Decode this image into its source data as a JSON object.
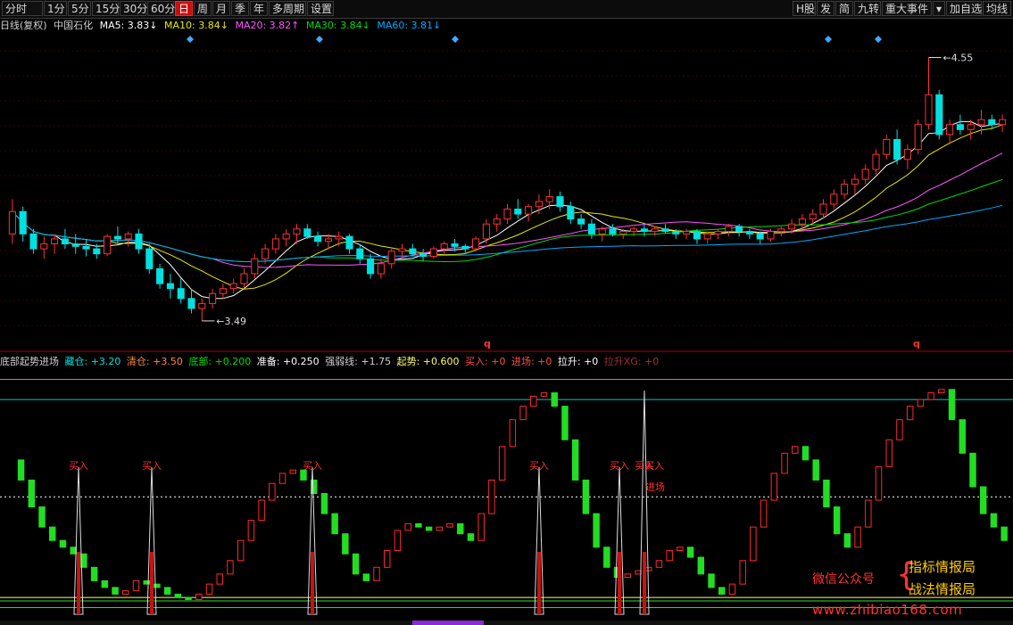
{
  "toolbar": {
    "left_items": [
      {
        "label": "分时",
        "name": "period-fenshi"
      },
      {
        "label": "1分",
        "name": "period-1min"
      },
      {
        "label": "5分",
        "name": "period-5min"
      },
      {
        "label": "15分",
        "name": "period-15min"
      },
      {
        "label": "30分",
        "name": "period-30min"
      },
      {
        "label": "60分",
        "name": "period-60min"
      },
      {
        "label": "日",
        "name": "period-day",
        "active": true
      },
      {
        "label": "周",
        "name": "period-week"
      },
      {
        "label": "月",
        "name": "period-month"
      },
      {
        "label": "季",
        "name": "period-quarter"
      },
      {
        "label": "年",
        "name": "period-year"
      },
      {
        "label": "多周期",
        "name": "period-multi"
      },
      {
        "label": "设置",
        "name": "settings"
      }
    ],
    "right_items": [
      {
        "label": "H股",
        "name": "h-share"
      },
      {
        "label": "发",
        "name": "fa"
      },
      {
        "label": "简",
        "name": "jian"
      },
      {
        "label": "九转",
        "name": "jiuzhuan"
      },
      {
        "label": "重大事件",
        "name": "major-events"
      },
      {
        "label": "▾",
        "name": "dropdown"
      },
      {
        "label": "加自选",
        "name": "add-watchlist"
      },
      {
        "label": "均线",
        "name": "ma-lines"
      }
    ]
  },
  "main_info": {
    "period": "日线(复权)",
    "stock": "中国石化",
    "ma5": "MA5: 3.83↓",
    "ma10": "MA10: 3.84↓",
    "ma20": "MA20: 3.82↑",
    "ma30": "MA30: 3.84↓",
    "ma60": "MA60: 3.81↓"
  },
  "price_labels": {
    "high": "4.55",
    "low": "3.49"
  },
  "markers": {
    "q": "q"
  },
  "sub_info": {
    "name": "底部起势进场",
    "cang": "藏仓: +3.20",
    "qingcang": "清仓: +3.50",
    "dibu": "底部: +0.200",
    "zhunbei": "准备: +0.250",
    "qiangruo": "强弱线: +1.75",
    "qishi": "起势: +0.600",
    "mairu": "买入: +0",
    "jinchang": "进场: +0",
    "lasheng": "拉升: +0",
    "lashengxg": "拉升XG: +0"
  },
  "signals": {
    "buy": "买入",
    "enter": "进场"
  },
  "watermark": {
    "wechat": "微信公众号",
    "line1": "指标情报局",
    "line2": "战法情报局",
    "url": "www.zhibiao168.com"
  },
  "colors": {
    "up": "#ff3232",
    "down": "#00e0e0",
    "ma5": "#ffffff",
    "ma10": "#e8e800",
    "ma20": "#ff55ff",
    "ma30": "#00dd00",
    "ma60": "#00aaff",
    "osc_up": "#ff2a2a",
    "osc_down": "#22dd22"
  },
  "chart_data": {
    "type": "candlestick",
    "candles": [
      [
        3.84,
        3.98,
        3.8,
        3.93
      ],
      [
        3.93,
        3.95,
        3.81,
        3.84
      ],
      [
        3.84,
        3.86,
        3.76,
        3.78
      ],
      [
        3.78,
        3.83,
        3.74,
        3.8
      ],
      [
        3.8,
        3.84,
        3.76,
        3.82
      ],
      [
        3.82,
        3.86,
        3.78,
        3.8
      ],
      [
        3.8,
        3.84,
        3.76,
        3.79
      ],
      [
        3.79,
        3.82,
        3.75,
        3.78
      ],
      [
        3.78,
        3.8,
        3.74,
        3.76
      ],
      [
        3.76,
        3.84,
        3.75,
        3.83
      ],
      [
        3.83,
        3.87,
        3.8,
        3.82
      ],
      [
        3.82,
        3.85,
        3.79,
        3.84
      ],
      [
        3.84,
        3.86,
        3.76,
        3.78
      ],
      [
        3.78,
        3.8,
        3.68,
        3.7
      ],
      [
        3.7,
        3.72,
        3.62,
        3.64
      ],
      [
        3.64,
        3.68,
        3.58,
        3.62
      ],
      [
        3.62,
        3.66,
        3.56,
        3.58
      ],
      [
        3.58,
        3.62,
        3.52,
        3.54
      ],
      [
        3.54,
        3.58,
        3.49,
        3.56
      ],
      [
        3.56,
        3.62,
        3.54,
        3.6
      ],
      [
        3.6,
        3.64,
        3.58,
        3.62
      ],
      [
        3.62,
        3.66,
        3.6,
        3.64
      ],
      [
        3.64,
        3.7,
        3.62,
        3.68
      ],
      [
        3.68,
        3.76,
        3.66,
        3.74
      ],
      [
        3.74,
        3.8,
        3.72,
        3.78
      ],
      [
        3.78,
        3.84,
        3.76,
        3.82
      ],
      [
        3.82,
        3.86,
        3.79,
        3.84
      ],
      [
        3.84,
        3.88,
        3.8,
        3.86
      ],
      [
        3.86,
        3.88,
        3.82,
        3.83
      ],
      [
        3.83,
        3.85,
        3.79,
        3.81
      ],
      [
        3.81,
        3.84,
        3.78,
        3.82
      ],
      [
        3.82,
        3.85,
        3.79,
        3.83
      ],
      [
        3.83,
        3.84,
        3.76,
        3.78
      ],
      [
        3.78,
        3.8,
        3.72,
        3.74
      ],
      [
        3.74,
        3.76,
        3.66,
        3.68
      ],
      [
        3.68,
        3.74,
        3.66,
        3.72
      ],
      [
        3.72,
        3.78,
        3.7,
        3.77
      ],
      [
        3.77,
        3.8,
        3.74,
        3.78
      ],
      [
        3.78,
        3.8,
        3.75,
        3.76
      ],
      [
        3.76,
        3.78,
        3.73,
        3.75
      ],
      [
        3.75,
        3.79,
        3.74,
        3.78
      ],
      [
        3.78,
        3.81,
        3.76,
        3.8
      ],
      [
        3.8,
        3.82,
        3.77,
        3.79
      ],
      [
        3.79,
        3.8,
        3.76,
        3.78
      ],
      [
        3.78,
        3.83,
        3.77,
        3.82
      ],
      [
        3.82,
        3.9,
        3.8,
        3.88
      ],
      [
        3.88,
        3.92,
        3.85,
        3.9
      ],
      [
        3.9,
        3.96,
        3.88,
        3.94
      ],
      [
        3.94,
        3.98,
        3.9,
        3.92
      ],
      [
        3.92,
        3.96,
        3.89,
        3.95
      ],
      [
        3.95,
        4.0,
        3.92,
        3.97
      ],
      [
        3.97,
        4.02,
        3.94,
        3.99
      ],
      [
        3.99,
        4.01,
        3.93,
        3.95
      ],
      [
        3.95,
        3.97,
        3.88,
        3.9
      ],
      [
        3.9,
        3.92,
        3.86,
        3.88
      ],
      [
        3.88,
        3.9,
        3.82,
        3.84
      ],
      [
        3.84,
        3.87,
        3.81,
        3.86
      ],
      [
        3.86,
        3.88,
        3.83,
        3.84
      ],
      [
        3.84,
        3.86,
        3.82,
        3.85
      ],
      [
        3.85,
        3.87,
        3.83,
        3.86
      ],
      [
        3.86,
        3.88,
        3.83,
        3.85
      ],
      [
        3.85,
        3.87,
        3.83,
        3.86
      ],
      [
        3.86,
        3.88,
        3.84,
        3.85
      ],
      [
        3.85,
        3.86,
        3.82,
        3.84
      ],
      [
        3.84,
        3.86,
        3.82,
        3.85
      ],
      [
        3.85,
        3.86,
        3.8,
        3.82
      ],
      [
        3.82,
        3.85,
        3.8,
        3.84
      ],
      [
        3.84,
        3.86,
        3.82,
        3.85
      ],
      [
        3.85,
        3.88,
        3.83,
        3.87
      ],
      [
        3.87,
        3.88,
        3.83,
        3.85
      ],
      [
        3.85,
        3.86,
        3.82,
        3.84
      ],
      [
        3.84,
        3.85,
        3.8,
        3.82
      ],
      [
        3.82,
        3.86,
        3.81,
        3.85
      ],
      [
        3.85,
        3.87,
        3.83,
        3.86
      ],
      [
        3.86,
        3.9,
        3.84,
        3.88
      ],
      [
        3.88,
        3.92,
        3.86,
        3.9
      ],
      [
        3.9,
        3.94,
        3.88,
        3.92
      ],
      [
        3.92,
        3.98,
        3.9,
        3.96
      ],
      [
        3.96,
        4.02,
        3.94,
        4.0
      ],
      [
        4.0,
        4.06,
        3.98,
        4.04
      ],
      [
        4.04,
        4.08,
        4.0,
        4.06
      ],
      [
        4.06,
        4.12,
        4.04,
        4.1
      ],
      [
        4.1,
        4.18,
        4.08,
        4.16
      ],
      [
        4.16,
        4.24,
        4.14,
        4.22
      ],
      [
        4.22,
        4.26,
        4.12,
        4.14
      ],
      [
        4.14,
        4.2,
        4.1,
        4.18
      ],
      [
        4.18,
        4.3,
        4.16,
        4.28
      ],
      [
        4.28,
        4.55,
        4.26,
        4.4
      ],
      [
        4.4,
        4.42,
        4.22,
        4.24
      ],
      [
        4.24,
        4.3,
        4.2,
        4.28
      ],
      [
        4.28,
        4.32,
        4.24,
        4.26
      ],
      [
        4.26,
        4.3,
        4.22,
        4.28
      ],
      [
        4.28,
        4.34,
        4.24,
        4.3
      ],
      [
        4.3,
        4.32,
        4.26,
        4.28
      ],
      [
        4.28,
        4.32,
        4.25,
        4.3
      ]
    ],
    "ylim": [
      3.4,
      4.62
    ],
    "oscillator": [
      2.3,
      2.0,
      1.6,
      1.3,
      1.1,
      1.0,
      0.9,
      0.7,
      0.5,
      0.4,
      0.3,
      0.35,
      0.5,
      0.45,
      0.4,
      0.3,
      0.25,
      0.22,
      0.3,
      0.45,
      0.6,
      0.8,
      1.1,
      1.4,
      1.7,
      1.95,
      2.1,
      2.15,
      2.0,
      1.8,
      1.5,
      1.2,
      0.9,
      0.6,
      0.5,
      0.7,
      0.95,
      1.25,
      1.35,
      1.3,
      1.25,
      1.3,
      1.35,
      1.2,
      1.1,
      1.5,
      2.0,
      2.5,
      2.9,
      3.1,
      3.25,
      3.3,
      3.1,
      2.6,
      2.0,
      1.5,
      1.0,
      0.7,
      0.55,
      0.6,
      0.65,
      0.7,
      0.8,
      0.95,
      1.0,
      0.85,
      0.6,
      0.4,
      0.3,
      0.45,
      0.8,
      1.3,
      1.7,
      2.1,
      2.4,
      2.5,
      2.3,
      2.0,
      1.6,
      1.2,
      1.0,
      1.3,
      1.7,
      2.2,
      2.6,
      2.9,
      3.1,
      3.2,
      3.3,
      3.35,
      2.9,
      2.4,
      1.9,
      1.5,
      1.3,
      1.1
    ],
    "osc_ylim": [
      0,
      3.6
    ],
    "osc_levels": {
      "cang": 3.2,
      "qingcang": 3.5,
      "dibu": 0.2,
      "zhunbei": 0.25,
      "qiangruo": 1.75
    }
  }
}
